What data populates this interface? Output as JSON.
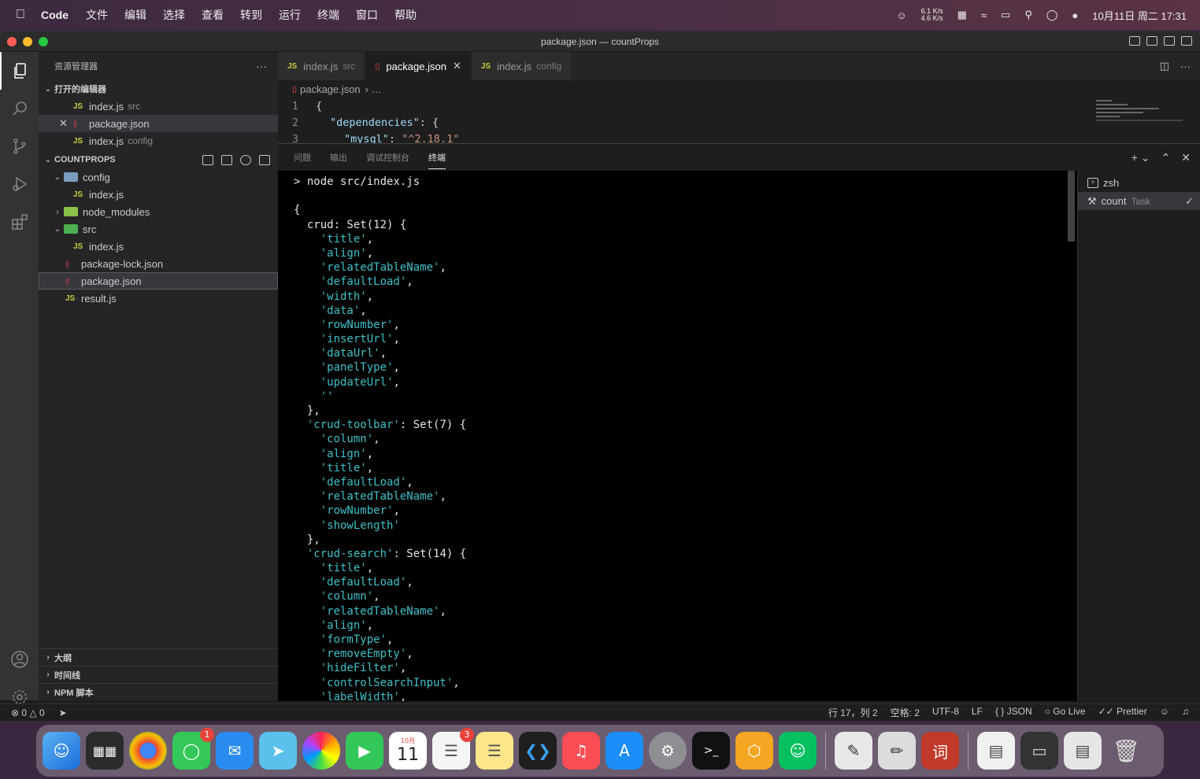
{
  "menubar": {
    "app_name": "Code",
    "menus": [
      "文件",
      "编辑",
      "选择",
      "查看",
      "转到",
      "运行",
      "终端",
      "窗口",
      "帮助"
    ],
    "net_up": "6.1 K/s",
    "net_down": "4.6 K/s",
    "clock": "10月11日 周二  17:31"
  },
  "window": {
    "title": "package.json — countProps"
  },
  "sidebar": {
    "header": "资源管理器",
    "more": "···",
    "open_editors_label": "打开的编辑器",
    "open_editors": [
      {
        "icon": "JS",
        "name": "index.js",
        "desc": "src"
      },
      {
        "icon": "{}",
        "name": "package.json",
        "desc": ""
      },
      {
        "icon": "JS",
        "name": "index.js",
        "desc": "config"
      }
    ],
    "project_label": "COUNTPROPS",
    "tree": {
      "config": "config",
      "config_index": "index.js",
      "node_modules": "node_modules",
      "src": "src",
      "src_index": "index.js",
      "package_lock": "package-lock.json",
      "package_json": "package.json",
      "result": "result.js"
    },
    "bottom": [
      "大纲",
      "时间线",
      "NPM 脚本"
    ]
  },
  "editor": {
    "tabs": [
      {
        "icon": "JS",
        "name": "index.js",
        "desc": "src"
      },
      {
        "icon": "{}",
        "name": "package.json",
        "desc": ""
      },
      {
        "icon": "JS",
        "name": "index.js",
        "desc": "config"
      }
    ],
    "breadcrumb": "package.json",
    "code": {
      "l1": "{",
      "l2_key": "\"dependencies\"",
      "l2_rest": ": {",
      "l3_key": "\"mysql\"",
      "l3_sep": ": ",
      "l3_val": "\"^2.18.1\""
    }
  },
  "panel": {
    "tabs": [
      "问题",
      "输出",
      "调试控制台",
      "终端"
    ],
    "terminals": [
      {
        "name": "zsh",
        "desc": ""
      },
      {
        "name": "count",
        "desc": "Task"
      }
    ],
    "output": {
      "prompt": "> node src/index.js",
      "crud_head": "crud: Set(12) {",
      "crud_items": [
        "'title'",
        "'align'",
        "'relatedTableName'",
        "'defaultLoad'",
        "'width'",
        "'data'",
        "'rowNumber'",
        "'insertUrl'",
        "'dataUrl'",
        "'panelType'",
        "'updateUrl'",
        "''"
      ],
      "toolbar_key": "'crud-toolbar'",
      "toolbar_rest": ": Set(7) {",
      "toolbar_items": [
        "'column'",
        "'align'",
        "'title'",
        "'defaultLoad'",
        "'relatedTableName'",
        "'rowNumber'",
        "'showLength'"
      ],
      "search_key": "'crud-search'",
      "search_rest": ": Set(14) {",
      "search_items": [
        "'title'",
        "'defaultLoad'",
        "'column'",
        "'relatedTableName'",
        "'align'",
        "'formType'",
        "'removeEmpty'",
        "'hideFilter'",
        "'controlSearchInput'",
        "'labelWidth'"
      ]
    }
  },
  "statusbar": {
    "errors": "0",
    "warnings": "0",
    "position": "行 17，列 2",
    "spaces": "空格: 2",
    "encoding": "UTF-8",
    "eol": "LF",
    "language": "JSON",
    "golive": "Go Live",
    "prettier": "Prettier"
  },
  "dock": {
    "calendar_month": "10月",
    "calendar_day": "11",
    "messages_badge": "1",
    "reminders_badge": "3",
    "dict_label": "词"
  }
}
